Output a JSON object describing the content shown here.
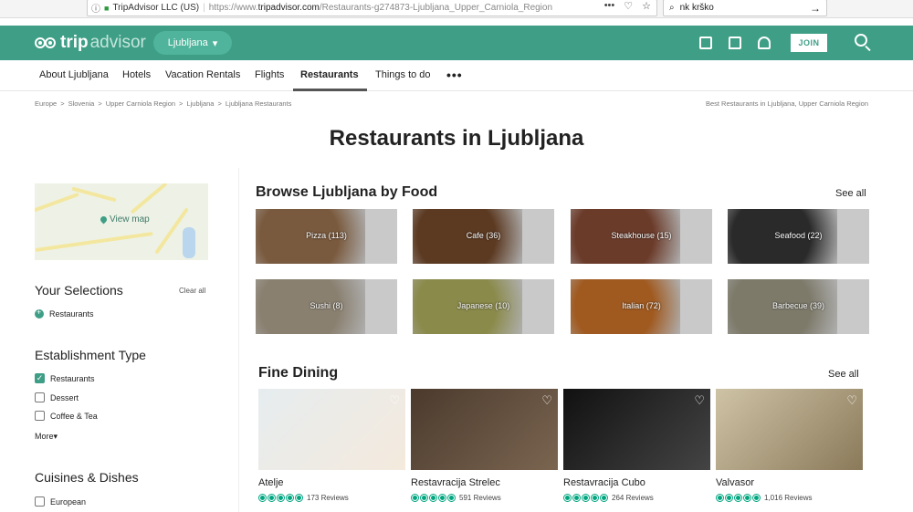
{
  "browser": {
    "org": "TripAdvisor LLC (US)",
    "url_prefix": "https://www.",
    "url_domain": "tripadvisor.com",
    "url_path": "/Restaurants-g274873-Ljubljana_Upper_Carniola_Region",
    "tools": [
      "•••",
      "♡",
      "☆"
    ],
    "search_value": "nk krško",
    "search_go": "→"
  },
  "header": {
    "logo_trip": "trip",
    "logo_advisor": "advisor",
    "city": "Ljubljana",
    "join_label": "JOIN",
    "icons": [
      "briefcase-icon",
      "chat-icon",
      "user-icon"
    ]
  },
  "nav": {
    "items": [
      "About Ljubljana",
      "Hotels",
      "Vacation Rentals",
      "Flights",
      "Restaurants",
      "Things to do"
    ],
    "active": "Restaurants",
    "more": "•••"
  },
  "breadcrumb": {
    "items": [
      "Europe",
      "Slovenia",
      "Upper Carniola Region",
      "Ljubljana",
      "Ljubljana Restaurants"
    ],
    "separator": ">",
    "right": "Best Restaurants in Ljubljana, Upper Carniola Region"
  },
  "page_title": "Restaurants in Ljubljana",
  "sidebar": {
    "view_map": "View map",
    "your_selections": "Your Selections",
    "clear_all": "Clear all",
    "selected": "Restaurants",
    "establishment_title": "Establishment Type",
    "establishment": [
      {
        "label": "Restaurants",
        "checked": true
      },
      {
        "label": "Dessert",
        "checked": false
      },
      {
        "label": "Coffee & Tea",
        "checked": false
      }
    ],
    "more": "More",
    "cuisines_title": "Cuisines & Dishes",
    "cuisines": [
      {
        "label": "European",
        "checked": false
      }
    ]
  },
  "browse": {
    "title": "Browse Ljubljana by Food",
    "see_all": "See all",
    "tiles": [
      {
        "label": "Pizza (113)",
        "color": "#7a5a3e"
      },
      {
        "label": "Cafe (36)",
        "color": "#5c3a22"
      },
      {
        "label": "Steakhouse (15)",
        "color": "#6b3b2a"
      },
      {
        "label": "Seafood (22)",
        "color": "#2a2a2a"
      },
      {
        "label": "Sushi (8)",
        "color": "#8a8070"
      },
      {
        "label": "Japanese (10)",
        "color": "#8a8a4a"
      },
      {
        "label": "Italian (72)",
        "color": "#a05a20"
      },
      {
        "label": "Barbecue (39)",
        "color": "#7d7a6a"
      }
    ]
  },
  "fine_dining": {
    "title": "Fine Dining",
    "see_all": "See all",
    "cards": [
      {
        "name": "Atelje",
        "reviews": "173 Reviews",
        "colors": [
          "#e6ecef",
          "#f4eadd"
        ]
      },
      {
        "name": "Restavracija Strelec",
        "reviews": "591 Reviews",
        "colors": [
          "#4b3a2d",
          "#7a6550"
        ]
      },
      {
        "name": "Restavracija Cubo",
        "reviews": "264 Reviews",
        "colors": [
          "#111111",
          "#444444"
        ]
      },
      {
        "name": "Valvasor",
        "reviews": "1,016 Reviews",
        "colors": [
          "#cfc3a6",
          "#8a7a5a"
        ]
      }
    ]
  },
  "colors": {
    "brand": "#3e9e86",
    "bubble": "#00a680"
  }
}
